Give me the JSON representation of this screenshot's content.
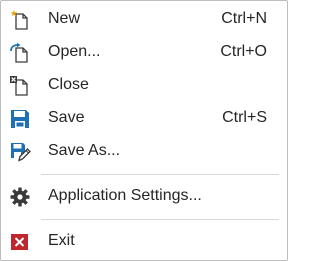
{
  "menu": {
    "items": [
      {
        "label": "New",
        "shortcut": "Ctrl+N",
        "icon": "new-file-icon"
      },
      {
        "label": "Open...",
        "shortcut": "Ctrl+O",
        "icon": "open-file-icon"
      },
      {
        "label": "Close",
        "shortcut": "",
        "icon": "close-file-icon"
      },
      {
        "label": "Save",
        "shortcut": "Ctrl+S",
        "icon": "save-icon"
      },
      {
        "label": "Save As...",
        "shortcut": "",
        "icon": "save-as-icon"
      },
      {
        "label": "Application Settings...",
        "shortcut": "",
        "icon": "gear-icon"
      },
      {
        "label": "Exit",
        "shortcut": "",
        "icon": "exit-icon"
      }
    ]
  },
  "colors": {
    "text": "#262626",
    "accent_blue": "#1e6fb5",
    "new_star": "#e8a400",
    "exit_red": "#c0262d",
    "separator": "#d9d9d9"
  }
}
